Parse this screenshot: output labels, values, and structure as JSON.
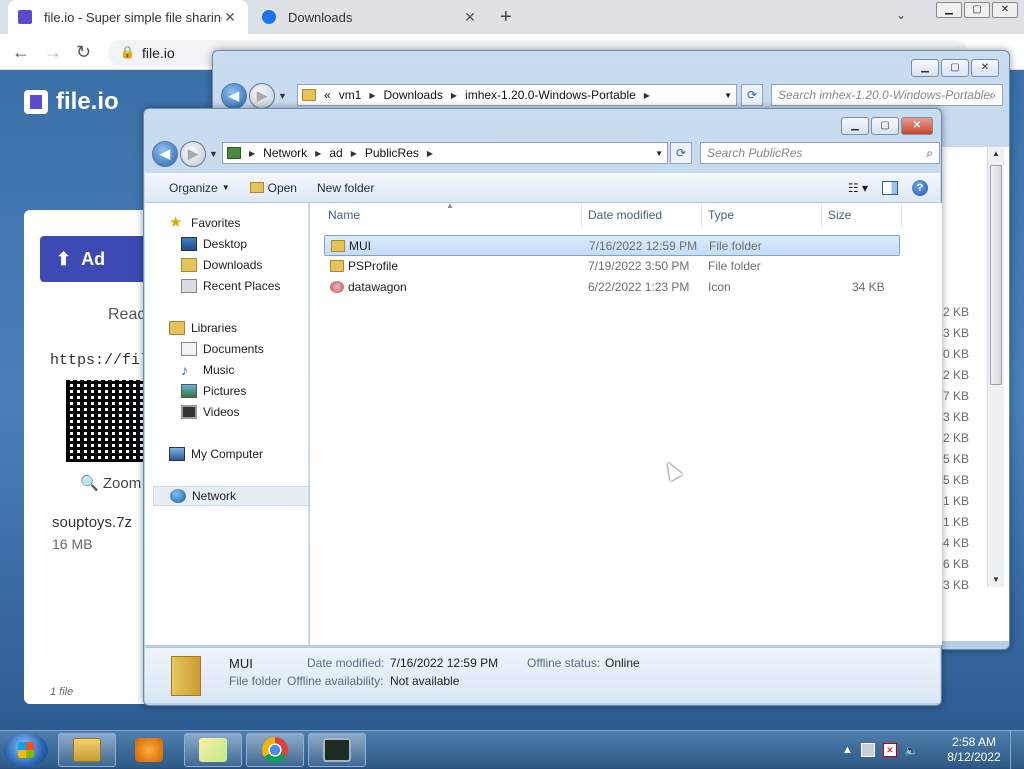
{
  "browser": {
    "tabs": [
      {
        "title": "file.io - Super simple file sharing",
        "color": "#5b4bd1"
      },
      {
        "title": "Downloads",
        "color": "#1a73e8"
      }
    ],
    "url": "file.io",
    "new_tab": "+",
    "tab_close": "✕",
    "tab_dropdown": "⌄",
    "nav": {
      "back": "←",
      "forward": "→",
      "reload": "↻",
      "lock": "🔒"
    }
  },
  "site": {
    "logo_text": "file.io",
    "upload_label": "Ad",
    "ready_label": "Read",
    "link_text": "https://fil",
    "zoom_label": "🔍 Zoom",
    "file_name": "souptoys.7z",
    "file_size": "16 MB",
    "file_count": "1 file"
  },
  "back_window": {
    "address": {
      "prefix": "«",
      "crumbs": [
        "vm1",
        "Downloads",
        "imhex-1.20.0-Windows-Portable"
      ]
    },
    "search_placeholder": "Search imhex-1.20.0-Windows-Portable",
    "sizes": [
      "2 KB",
      "3 KB",
      "0 KB",
      "2 KB",
      "7 KB",
      "3 KB",
      "2 KB",
      "5 KB",
      "5 KB",
      "1 KB",
      "1 KB",
      "4 KB",
      "6 KB",
      "3 KB"
    ]
  },
  "window": {
    "address": {
      "crumbs": [
        "Network",
        "ad",
        "PublicRes"
      ]
    },
    "search_placeholder": "Search PublicRes",
    "commands": {
      "organize": "Organize",
      "open": "Open",
      "new_folder": "New folder",
      "help": "?"
    },
    "caption": {
      "min": "▁",
      "max": "▢",
      "close": "✕"
    },
    "nav_tree": {
      "favorites": "Favorites",
      "desktop": "Desktop",
      "downloads": "Downloads",
      "recent_places": "Recent Places",
      "libraries": "Libraries",
      "documents": "Documents",
      "music": "Music",
      "pictures": "Pictures",
      "videos": "Videos",
      "my_computer": "My Computer",
      "network": "Network"
    },
    "columns": {
      "name": "Name",
      "date": "Date modified",
      "type": "Type",
      "size": "Size"
    },
    "files": [
      {
        "name": "MUI",
        "date": "7/16/2022 12:59 PM",
        "type": "File folder",
        "size": "",
        "icon": "folder-icon",
        "selected": true
      },
      {
        "name": "PSProfile",
        "date": "7/19/2022 3:50 PM",
        "type": "File folder",
        "size": "",
        "icon": "folder-icon",
        "selected": false
      },
      {
        "name": "datawagon",
        "date": "6/22/2022 1:23 PM",
        "type": "Icon",
        "size": "34 KB",
        "icon": "image-file-icon",
        "selected": false
      }
    ],
    "details": {
      "name": "MUI",
      "type": "File folder",
      "date_label": "Date modified:",
      "date_value": "7/16/2022 12:59 PM",
      "offline_status_label": "Offline status:",
      "offline_status_value": "Online",
      "offline_avail_label": "Offline availability:",
      "offline_avail_value": "Not available"
    }
  },
  "taskbar": {
    "clock_time": "2:58 AM",
    "clock_date": "8/12/2022",
    "apps": [
      "explorer-icon",
      "media-player-icon",
      "sticky-notes-icon",
      "chrome-icon",
      "command-prompt-icon"
    ]
  }
}
